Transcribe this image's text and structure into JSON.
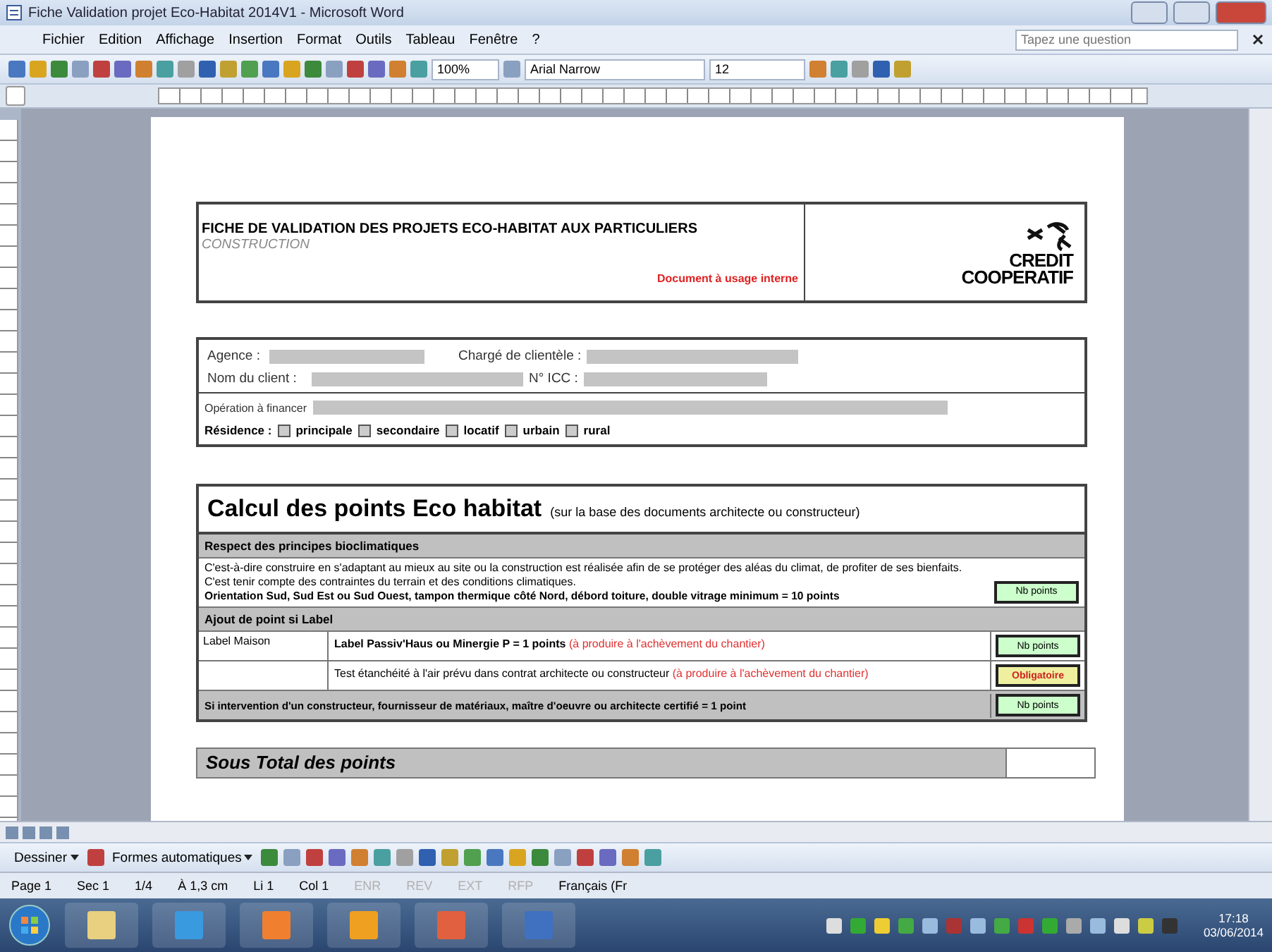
{
  "window": {
    "title": "Fiche Validation projet Eco-Habitat 2014V1 - Microsoft Word"
  },
  "menu": [
    "Fichier",
    "Edition",
    "Affichage",
    "Insertion",
    "Format",
    "Outils",
    "Tableau",
    "Fenêtre",
    "?"
  ],
  "help_field": {
    "placeholder": "Tapez une question"
  },
  "toolbar": {
    "zoom": "100%",
    "font": "Arial Narrow",
    "size": "12"
  },
  "document": {
    "header": {
      "title": "FICHE DE VALIDATION DES PROJETS ECO-HABITAT AUX PARTICULIERS",
      "subtitle": "CONSTRUCTION",
      "note": "Document à usage interne",
      "logo": [
        "CREDIT",
        "COOPERATIF"
      ]
    },
    "client_info": {
      "rows": [
        [
          {
            "label": "Agence :"
          },
          {
            "label": "Chargé de clientèle :"
          }
        ],
        [
          {
            "label": "Nom du client :"
          },
          {
            "label": "N° ICC :"
          }
        ]
      ],
      "operation_label": "Opération à financer",
      "residence_label": "Résidence :",
      "residence_options": [
        {
          "label": "principale",
          "checked": false
        },
        {
          "label": "secondaire",
          "checked": false
        },
        {
          "label": "locatif",
          "checked": false
        },
        {
          "label": "urbain",
          "checked": false
        },
        {
          "label": "rural",
          "checked": false
        }
      ]
    },
    "points_table": {
      "title": "Calcul des points Eco habitat",
      "title_note": "(sur la base des documents architecte ou constructeur)",
      "bioclimatic": {
        "heading": "Respect des principes bioclimatiques",
        "description": "C'est-à-dire construire en s'adaptant au mieux au site ou la construction est réalisée afin de se protéger des aléas du climat, de profiter de ses bienfaits. C'est tenir compte des contraintes du terrain et des conditions climatiques.",
        "criterion": "Orientation Sud, Sud Est ou Sud Ouest, tampon thermique côté Nord, débord toiture, double vitrage minimum = 10 points",
        "points": "Nb points"
      },
      "label_heading": "Ajout de point si Label",
      "label_rows": [
        {
          "kind": "points",
          "category": "Label Maison",
          "text": "Label Passiv'Haus ou Minergie P = 1 points",
          "note": "(à produire à l'achèvement du chantier)",
          "points": "Nb points"
        },
        {
          "kind": "required",
          "text": "Test étanchéité à l'air prévu dans contrat architecte ou constructeur",
          "note": "(à produire à l'achèvement du chantier)",
          "points": "Obligatoire"
        }
      ],
      "certified": {
        "text": "Si intervention d'un constructeur, fournisseur de matériaux, maître d'oeuvre ou architecte certifié = 1 point",
        "points": "Nb points"
      }
    },
    "subtotal": {
      "label": "Sous Total des points"
    }
  },
  "draw_toolbar": {
    "draw_menu": "Dessiner",
    "autoshapes": "Formes automatiques"
  },
  "status_bar": [
    {
      "text": "Page 1",
      "disabled": false
    },
    {
      "text": "Sec 1",
      "disabled": false
    },
    {
      "text": "1/4",
      "disabled": false
    },
    {
      "text": "À 1,3 cm",
      "disabled": false
    },
    {
      "text": "Li 1",
      "disabled": false
    },
    {
      "text": "Col 1",
      "disabled": false
    },
    {
      "text": "ENR",
      "disabled": true
    },
    {
      "text": "REV",
      "disabled": true
    },
    {
      "text": "EXT",
      "disabled": true
    },
    {
      "text": "RFP",
      "disabled": true
    },
    {
      "text": "Français (Fr",
      "disabled": false
    }
  ],
  "taskbar": {
    "time": "17:18",
    "date": "03/06/2014"
  }
}
